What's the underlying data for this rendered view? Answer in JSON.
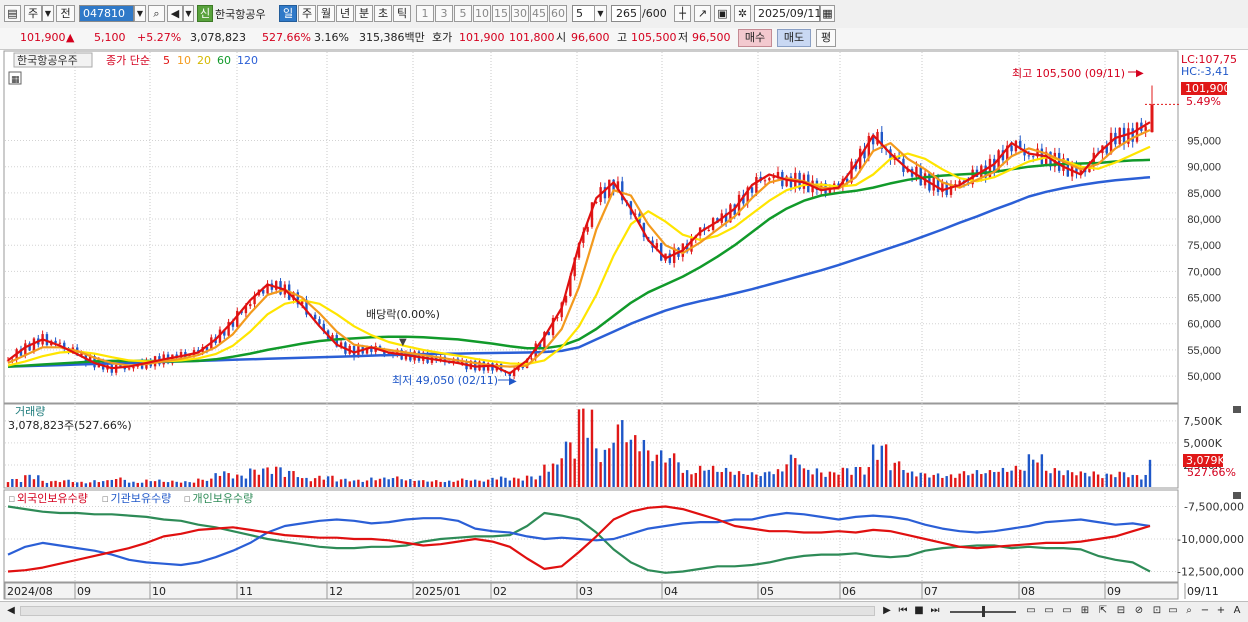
{
  "toolbar": {
    "market": "주",
    "prev_label": "전",
    "code": "047810",
    "name": "한국항공우",
    "badge_new": "신",
    "periods": [
      "일",
      "주",
      "월",
      "년",
      "분",
      "초",
      "틱"
    ],
    "intervals": [
      "1",
      "3",
      "5",
      "10",
      "15",
      "30",
      "45",
      "60"
    ],
    "interval_input": "5",
    "count": "265",
    "count_max": "/600",
    "date": "2025/09/11"
  },
  "quote": {
    "price": "101,900",
    "arrow": "▲",
    "change": "5,100",
    "change_pct": "+5.27%",
    "volume": "3,078,823",
    "volume_ratio": "527.66%",
    "turnover": "3.16%",
    "amount": "315,386백만",
    "hoga_label": "호가",
    "bid": "101,900",
    "ask": "101,800",
    "open_label": "시",
    "open": "96,600",
    "high_label": "고",
    "high": "105,500",
    "low_label": "저",
    "low": "96,500",
    "buy_label": "매수",
    "sell_label": "매도",
    "eval_label": "평"
  },
  "chart_data": {
    "type": "candlestick",
    "legend": {
      "title": "한국항공우주",
      "series_label": "종가 단순",
      "ma_periods": [
        "5",
        "10",
        "20",
        "60",
        "120"
      ]
    },
    "price_axis": {
      "ticks": [
        "95,000",
        "90,000",
        "85,000",
        "80,000",
        "75,000",
        "70,000",
        "65,000",
        "60,000",
        "55,000",
        "50,000"
      ],
      "ylim": [
        46000,
        110000
      ],
      "lc": "LC:107,75",
      "hc": "HC:-3,41",
      "current": "101,900",
      "current_pct": "5.49%"
    },
    "annotations": {
      "high": "최고 105,500 (09/11)",
      "low": "최저 49,050 (02/11)",
      "dividend": "배당락(0.00%)"
    },
    "x_labels": [
      "2024/08",
      "09",
      "10",
      "11",
      "12",
      "2025/01",
      "02",
      "03",
      "04",
      "05",
      "06",
      "07",
      "08",
      "09",
      "09/11"
    ],
    "ma_colors": {
      "ma5": "#e01010",
      "ma10": "#f39a1d",
      "ma20": "#ffe500",
      "ma60": "#119a2a",
      "ma120": "#2b5fd6"
    },
    "ma5": [
      53000,
      55500,
      57000,
      55800,
      54200,
      52500,
      51500,
      51800,
      52500,
      53200,
      53800,
      54500,
      57000,
      60500,
      64500,
      67500,
      66500,
      63500,
      59500,
      56000,
      54500,
      55500,
      54500,
      54000,
      53500,
      53000,
      52500,
      51800,
      52000,
      50500,
      53000,
      57500,
      63000,
      75000,
      84000,
      87000,
      82000,
      76000,
      72500,
      74000,
      77500,
      79500,
      82000,
      86500,
      88500,
      87500,
      87000,
      85500,
      86000,
      90500,
      96000,
      92500,
      89500,
      87500,
      85500,
      86500,
      88500,
      90500,
      94500,
      92500,
      92000,
      90000,
      88500,
      92500,
      95500,
      96500,
      98500
    ],
    "ma10": [
      52500,
      54000,
      55500,
      55500,
      54800,
      53500,
      52500,
      52000,
      52300,
      52800,
      53300,
      54000,
      55500,
      58000,
      62000,
      65500,
      66500,
      65000,
      62000,
      58500,
      56000,
      55500,
      55000,
      54500,
      54000,
      53500,
      53000,
      52500,
      52000,
      51800,
      52000,
      55000,
      59000,
      67000,
      78000,
      85500,
      84500,
      79000,
      75000,
      73500,
      75500,
      78000,
      80500,
      84000,
      87000,
      87800,
      87200,
      86000,
      85800,
      88000,
      93000,
      94500,
      91500,
      89500,
      87000,
      86000,
      87500,
      89000,
      92000,
      93500,
      92500,
      91000,
      89500,
      90500,
      93500,
      95500,
      97000
    ],
    "ma20": [
      52000,
      52800,
      53800,
      54500,
      54700,
      54300,
      53600,
      53000,
      52800,
      52800,
      53000,
      53400,
      54200,
      55800,
      58500,
      61800,
      63800,
      64500,
      63800,
      61800,
      59500,
      57800,
      56500,
      55700,
      55000,
      54400,
      53900,
      53300,
      52800,
      52400,
      52300,
      53000,
      55500,
      59500,
      65500,
      73000,
      79000,
      81500,
      79500,
      77000,
      76000,
      76800,
      78500,
      81000,
      83500,
      85500,
      86500,
      86600,
      86200,
      86500,
      88500,
      91500,
      92500,
      91500,
      89500,
      87800,
      87200,
      88000,
      89500,
      91000,
      91800,
      91200,
      90000,
      89600,
      90800,
      92300,
      93800
    ],
    "ma60": [
      51800,
      52000,
      52200,
      52400,
      52600,
      52800,
      52900,
      52900,
      52900,
      52800,
      52800,
      52900,
      53200,
      53700,
      54300,
      55000,
      55600,
      56200,
      56700,
      57000,
      57200,
      57400,
      57500,
      57500,
      57400,
      57200,
      57000,
      56600,
      56200,
      55700,
      55300,
      55300,
      55800,
      57000,
      59000,
      61500,
      64000,
      66000,
      67500,
      69000,
      70800,
      72800,
      75000,
      77500,
      80000,
      82000,
      83500,
      84500,
      85000,
      85400,
      86000,
      86800,
      87500,
      88000,
      88300,
      88500,
      88700,
      89000,
      89500,
      90000,
      90300,
      90500,
      90600,
      90700,
      91000,
      91200,
      91300
    ],
    "ma120": [
      51800,
      51900,
      52000,
      52100,
      52200,
      52300,
      52400,
      52500,
      52600,
      52700,
      52800,
      52900,
      53000,
      53100,
      53200,
      53300,
      53400,
      53500,
      53600,
      53700,
      53800,
      53900,
      54000,
      54100,
      54200,
      54250,
      54300,
      54350,
      54400,
      54450,
      54500,
      54600,
      54800,
      55500,
      57000,
      58500,
      60000,
      61300,
      62500,
      63500,
      64300,
      65000,
      65800,
      66600,
      67500,
      68400,
      69300,
      70200,
      71200,
      72300,
      73400,
      74500,
      75600,
      76800,
      78000,
      79300,
      80500,
      81800,
      83000,
      84300,
      85200,
      85900,
      86500,
      87000,
      87400,
      87700,
      88000
    ],
    "volume_axis": {
      "title": "거래량",
      "current": "3,078,823주(527.66%)",
      "ticks": [
        "7,500K",
        "5,000K",
        "2,500K"
      ],
      "badge": "3,079K",
      "badge_pct": "527.66%"
    },
    "volume": [
      800,
      1200,
      600,
      700,
      500,
      650,
      900,
      500,
      700,
      600,
      550,
      800,
      1500,
      1200,
      1800,
      2000,
      1600,
      900,
      1100,
      800,
      700,
      900,
      1000,
      750,
      650,
      600,
      800,
      700,
      1000,
      900,
      1100,
      2300,
      4500,
      7800,
      3800,
      6500,
      5000,
      3500,
      3200,
      1600,
      2000,
      1800,
      1500,
      1400,
      1700,
      3100,
      1800,
      1500,
      1900,
      2000,
      4200,
      2500,
      1500,
      1300,
      1200,
      1500,
      1600,
      1800,
      2000,
      3100,
      1800,
      1600,
      1500,
      1300,
      1500,
      1200,
      3079
    ],
    "holdings_legend": [
      "외국인보유수량",
      "기관보유수량",
      "개인보유수량"
    ],
    "holdings_axis": {
      "ticks": [
        "-7,500,000",
        "-10,000,000",
        "-12,500,000"
      ]
    },
    "foreign_hold": [
      -12500000,
      -12400000,
      -12200000,
      -11900000,
      -11600000,
      -11300000,
      -11000000,
      -10700000,
      -10300000,
      -9800000,
      -9600000,
      -9300000,
      -9200000,
      -9100000,
      -9300000,
      -9500000,
      -9700000,
      -9800000,
      -9900000,
      -9900000,
      -10000000,
      -10000000,
      -10100000,
      -10300000,
      -10500000,
      -10400000,
      -10200000,
      -10000000,
      -10200000,
      -10600000,
      -11500000,
      -12300000,
      -12100000,
      -11000000,
      -9800000,
      -8500000,
      -7900000,
      -7600000,
      -7500000,
      -7700000,
      -8100000,
      -8500000,
      -9000000,
      -9200000,
      -9400000,
      -9400000,
      -9500000,
      -9500000,
      -9400000,
      -9500000,
      -9300000,
      -9400000,
      -9700000,
      -10000000,
      -10300000,
      -10600000,
      -10700000,
      -10600000,
      -10500000,
      -10400000,
      -10300000,
      -10300000,
      -10200000,
      -10000000,
      -9800000,
      -9400000,
      -9000000
    ],
    "institution_hold": [
      -7500000,
      -7700000,
      -7900000,
      -8000000,
      -8000000,
      -8100000,
      -8100000,
      -8200000,
      -8300000,
      -8500000,
      -8600000,
      -8900000,
      -9100000,
      -9400000,
      -9700000,
      -10000000,
      -10200000,
      -10400000,
      -10600000,
      -10700000,
      -10700000,
      -10600000,
      -10600000,
      -10500000,
      -10200000,
      -10000000,
      -9900000,
      -9800000,
      -9800000,
      -9700000,
      -9000000,
      -8000000,
      -8200000,
      -8500000,
      -9500000,
      -10800000,
      -11800000,
      -12400000,
      -12600000,
      -12500000,
      -12300000,
      -12100000,
      -12100000,
      -12000000,
      -11800000,
      -11500000,
      -11300000,
      -11200000,
      -11200000,
      -11100000,
      -11300000,
      -11400000,
      -11300000,
      -10900000,
      -10700000,
      -10600000,
      -10500000,
      -10500000,
      -10700000,
      -10600000,
      -10700000,
      -10700000,
      -10800000,
      -11300000,
      -11600000,
      -11800000,
      -12500000
    ],
    "individual_hold": [
      -11200000,
      -10600000,
      -10300000,
      -10500000,
      -10700000,
      -10900000,
      -11200000,
      -11600000,
      -11800000,
      -11900000,
      -12000000,
      -11800000,
      -11400000,
      -10900000,
      -10300000,
      -9500000,
      -9000000,
      -8800000,
      -8600000,
      -8500000,
      -8600000,
      -8800000,
      -8700000,
      -8500000,
      -8400000,
      -8400000,
      -8600000,
      -9200000,
      -9400000,
      -9500000,
      -9800000,
      -10000000,
      -9900000,
      -10000000,
      -10100000,
      -10000000,
      -9600000,
      -9200000,
      -9000000,
      -8800000,
      -8700000,
      -8700000,
      -8500000,
      -8500000,
      -8200000,
      -8000000,
      -8100000,
      -8300000,
      -8500000,
      -8300000,
      -8200000,
      -8300000,
      -8500000,
      -8900000,
      -9200000,
      -9400000,
      -9500000,
      -9400000,
      -9200000,
      -9000000,
      -8700000,
      -8600000,
      -8500000,
      -8700000,
      -8900000,
      -8800000,
      -9000000
    ]
  },
  "statusbar": {
    "buttons": [
      "▶",
      "⏮",
      "■",
      "⏭",
      "−",
      "+",
      "A"
    ]
  }
}
